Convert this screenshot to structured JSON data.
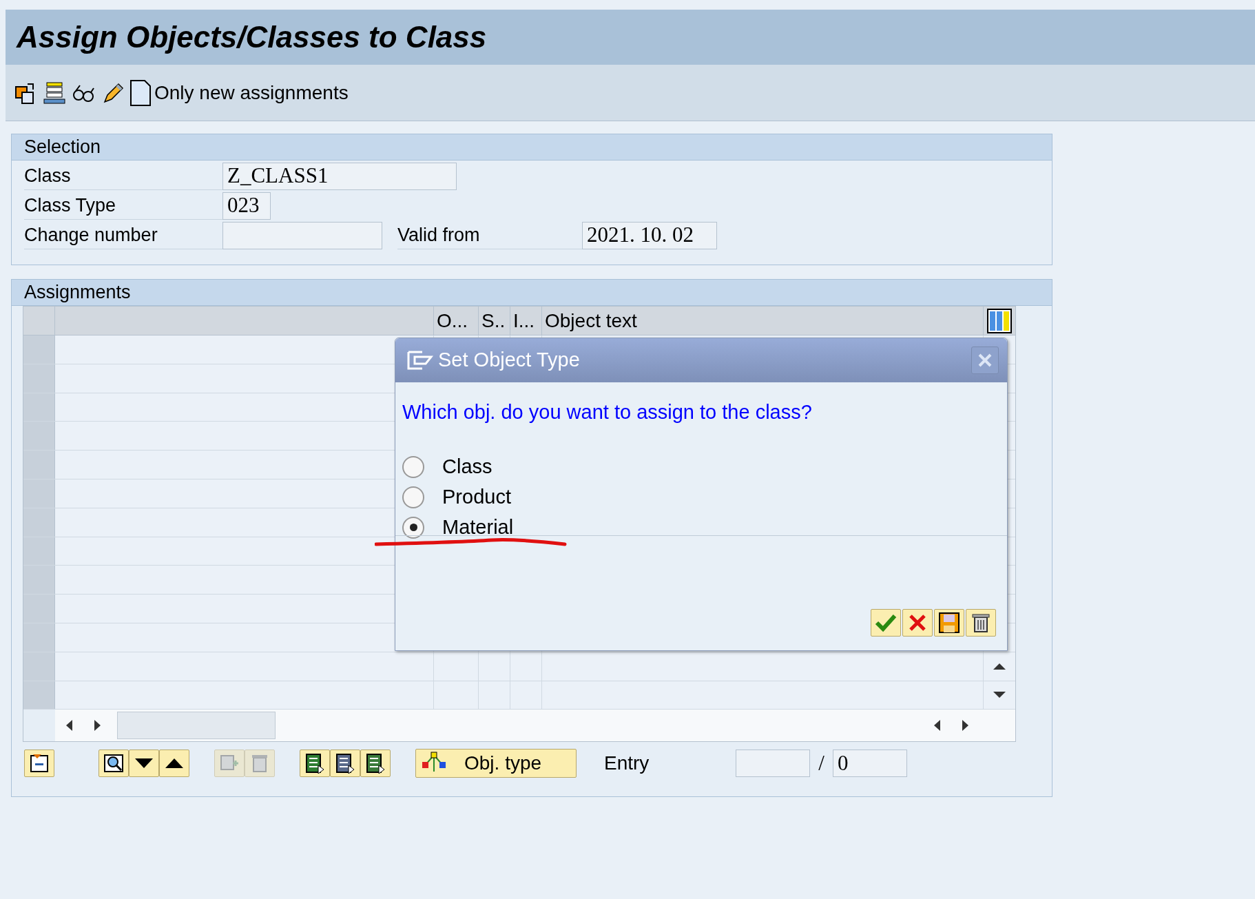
{
  "window": {
    "title": "Assign Objects/Classes to Class"
  },
  "toolbar": {
    "label": "Only new assignments"
  },
  "selection": {
    "title": "Selection",
    "fields": [
      {
        "label": "Class",
        "value": "Z_CLASS1",
        "kind": "long"
      },
      {
        "label": "Class Type",
        "value": "023",
        "kind": "short"
      },
      {
        "label": "Change number",
        "kind": "medium"
      }
    ],
    "valid_from": {
      "label": "Valid from",
      "value": "2021. 10. 02"
    }
  },
  "assignments": {
    "title": "Assignments",
    "columns": [
      "O...",
      "S..",
      "I...",
      "Object text"
    ],
    "obj_type_button": "Obj. type",
    "entry_label": "Entry",
    "entry_separator": "/",
    "entry_total": "0"
  },
  "dialog": {
    "title": "Set Object Type",
    "question": "Which obj. do you want to assign to the class?",
    "options": [
      {
        "label": "Class",
        "selected": false
      },
      {
        "label": "Product",
        "selected": false
      },
      {
        "label": "Material",
        "selected": true
      }
    ]
  }
}
